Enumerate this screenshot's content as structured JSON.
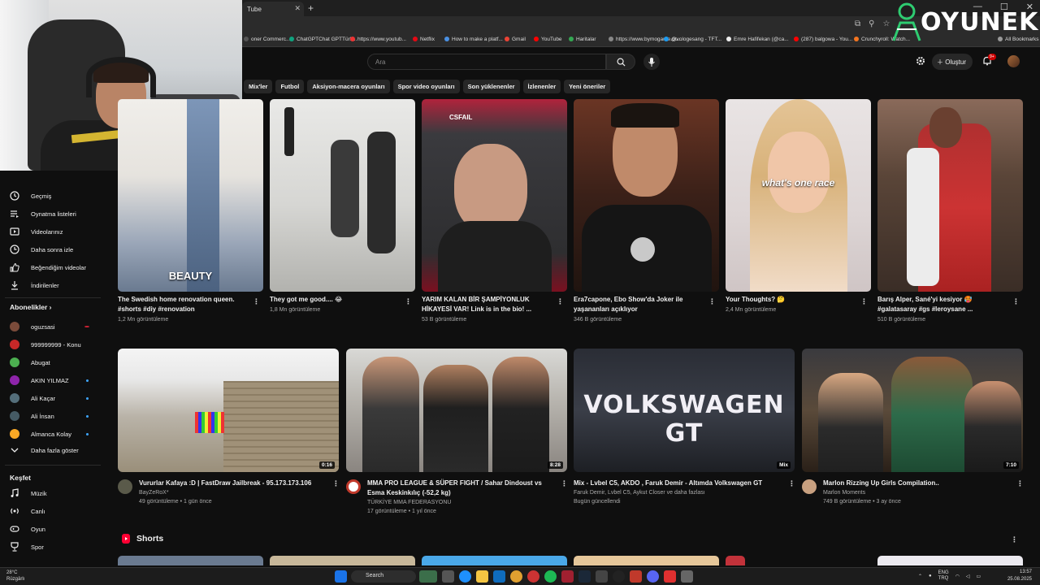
{
  "browser": {
    "tab_title": "Tube",
    "bookmarks": [
      "oner Commerc...",
      "ChatGPTChat GPTTürk...",
      "https://www.youtub...",
      "Netflix",
      "How to make a platf...",
      "Gmail",
      "YouTube",
      "Haritalar",
      "https://www.bymogame.co...",
      "@vologesang - TFT...",
      "Emre Hafifekan (@ca...",
      "(287) balgowa - You...",
      "Crunchyroll: Watch...",
      "All Bookmarks"
    ]
  },
  "watermark": {
    "text": "OYUNEKS"
  },
  "header": {
    "search_placeholder": "Ara",
    "create_label": "Oluştur",
    "notifications": "9+"
  },
  "chips": [
    "Mix'ler",
    "Futbol",
    "Aksiyon-macera oyunları",
    "Spor video oyunları",
    "Son yüklenenler",
    "İzlenenler",
    "Yeni öneriler"
  ],
  "sidebar": {
    "you_items": [
      {
        "label": "Geçmiş",
        "icon": "history-icon"
      },
      {
        "label": "Oynatma listeleri",
        "icon": "playlist-icon"
      },
      {
        "label": "Videolarınız",
        "icon": "your-videos-icon"
      },
      {
        "label": "Daha sonra izle",
        "icon": "watch-later-icon"
      },
      {
        "label": "Beğendiğim videolar",
        "icon": "like-icon"
      },
      {
        "label": "İndirilenler",
        "icon": "download-icon"
      }
    ],
    "subs_heading": "Abonelikler",
    "subscriptions": [
      {
        "label": "oguzsasi",
        "color": "#7a4b3a",
        "live": "red"
      },
      {
        "label": "999999999 - Konu",
        "color": "#c62828",
        "live": ""
      },
      {
        "label": "Abugat",
        "color": "#4caf50",
        "live": ""
      },
      {
        "label": "AKIN YILMAZ",
        "color": "#8e24aa",
        "live": "blue"
      },
      {
        "label": "Ali Kaçar",
        "color": "#546e7a",
        "live": "blue"
      },
      {
        "label": "Ali İnsan",
        "color": "#455a64",
        "live": "blue"
      },
      {
        "label": "Almanca Kolay",
        "color": "#f9a825",
        "live": "blue"
      }
    ],
    "show_more": "Daha fazla göster",
    "explore_heading": "Keşfet",
    "explore_items": [
      {
        "label": "Müzik",
        "icon": "music-icon"
      },
      {
        "label": "Canlı",
        "icon": "live-icon"
      },
      {
        "label": "Oyun",
        "icon": "gaming-icon"
      },
      {
        "label": "Spor",
        "icon": "sports-icon"
      }
    ]
  },
  "shorts": [
    {
      "title": "The Swedish home renovation queen. #shorts #diy #renovation",
      "views": "1,2 Mn görüntüleme",
      "overlay": "BEAUTY"
    },
    {
      "title": "They got me good.... 😂",
      "views": "1,8 Mn görüntüleme",
      "overlay": ""
    },
    {
      "title": "YARIM KALAN BİR ŞAMPİYONLUK HİKAYESİ VAR! Link is in the bio! ...",
      "views": "53 B görüntüleme",
      "overlay": "CSFAIL"
    },
    {
      "title": "Era7capone, Ebo Show'da Joker ile yaşananları açıklıyor",
      "views": "346 B görüntüleme",
      "overlay": ""
    },
    {
      "title": "Your Thoughts? 🤔",
      "views": "2,4 Mn görüntüleme",
      "overlay": "what's one race"
    },
    {
      "title": "Barış Alper, Sané'yi kesiyor 🥵 #galatasaray #gs #leroysane ...",
      "views": "510 B görüntüleme",
      "overlay": ""
    }
  ],
  "videos": [
    {
      "title": "Vururlar Kafaya :D | FastDraw Jailbreak - 95.173.173.106",
      "channel": "BayZeRoX*",
      "meta": "49 görüntüleme • 1 gün önce",
      "duration": "0:16"
    },
    {
      "title": "MMA PRO LEAGUE & SÜPER FIGHT / Sahar Dindoust vs Esma Keskinkılıç (-52,2 kg)",
      "channel": "TÜRKİYE MMA FEDERASYONU",
      "meta": "17 görüntüleme • 1 yıl önce",
      "duration": "8:28"
    },
    {
      "title": "Mix - Lvbel C5, AKDO , Faruk Demir - Altımda Volkswagen GT",
      "channel": "Faruk Demir, Lvbel C5, Aykut Closer ve daha fazlası",
      "meta": "Bugün güncellendi",
      "duration": "Mix",
      "overlay": "VOLKSWAGEN GT"
    },
    {
      "title": "Marlon Rizzing Up Girls Compilation..",
      "channel": "Marlon Moments",
      "meta": "749 B görüntüleme • 3 ay önce",
      "duration": "7:10"
    }
  ],
  "shorts_heading": "Shorts",
  "taskbar": {
    "weather_temp": "28°C",
    "weather_desc": "Rüzgârlı",
    "search_label": "Search",
    "lang": "ENG",
    "lang2": "TRQ",
    "time": "13:57",
    "date": "25.08.2025"
  }
}
